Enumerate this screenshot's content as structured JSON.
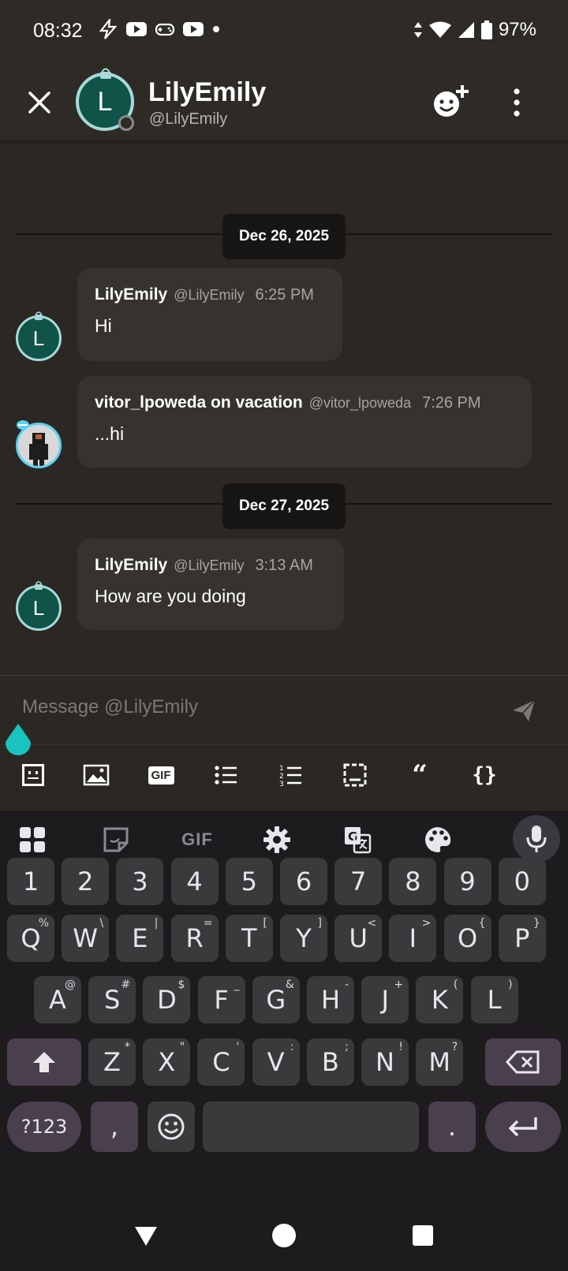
{
  "status_bar": {
    "time": "08:32",
    "battery": "97%"
  },
  "header": {
    "avatar_letter": "L",
    "name": "LilyEmily",
    "handle": "@LilyEmily"
  },
  "chat": {
    "date_separators": [
      "Dec 26, 2025",
      "Dec 27, 2025"
    ],
    "messages": [
      {
        "name": "LilyEmily",
        "handle": "@LilyEmily",
        "time": "6:25 PM",
        "text": "Hi",
        "avatar_letter": "L"
      },
      {
        "name": "vitor_lpoweda on vacation",
        "handle": "@vitor_lpoweda",
        "time": "7:26 PM",
        "text": "...hi"
      },
      {
        "name": "LilyEmily",
        "handle": "@LilyEmily",
        "time": "3:13 AM",
        "text": "How are you doing",
        "avatar_letter": "L"
      }
    ]
  },
  "composer": {
    "placeholder": "Message @LilyEmily"
  },
  "format_toolbar": {
    "gif_label": "GIF",
    "quote_label": "“",
    "code_label": "{}"
  },
  "keyboard": {
    "toolbar_gif": "GIF",
    "number_row": [
      "1",
      "2",
      "3",
      "4",
      "5",
      "6",
      "7",
      "8",
      "9",
      "0"
    ],
    "row1": [
      {
        "k": "Q",
        "h": "%"
      },
      {
        "k": "W",
        "h": "\\"
      },
      {
        "k": "E",
        "h": "|"
      },
      {
        "k": "R",
        "h": "="
      },
      {
        "k": "T",
        "h": "["
      },
      {
        "k": "Y",
        "h": "]"
      },
      {
        "k": "U",
        "h": "<"
      },
      {
        "k": "I",
        "h": ">"
      },
      {
        "k": "O",
        "h": "{"
      },
      {
        "k": "P",
        "h": "}"
      }
    ],
    "row2": [
      {
        "k": "A",
        "h": "@"
      },
      {
        "k": "S",
        "h": "#"
      },
      {
        "k": "D",
        "h": "$"
      },
      {
        "k": "F",
        "h": "_"
      },
      {
        "k": "G",
        "h": "&"
      },
      {
        "k": "H",
        "h": "-"
      },
      {
        "k": "J",
        "h": "+"
      },
      {
        "k": "K",
        "h": "("
      },
      {
        "k": "L",
        "h": ")"
      }
    ],
    "row3": [
      {
        "k": "Z",
        "h": "*"
      },
      {
        "k": "X",
        "h": "\""
      },
      {
        "k": "C",
        "h": "'"
      },
      {
        "k": "V",
        "h": ":"
      },
      {
        "k": "B",
        "h": ";"
      },
      {
        "k": "N",
        "h": "!"
      },
      {
        "k": "M",
        "h": "?"
      }
    ],
    "symbols_key": "?123",
    "comma_key": ",",
    "period_key": "."
  },
  "colors": {
    "background": "#2b2824",
    "bubble": "#36322e",
    "avatar_fill": "#0f5349",
    "avatar_ring": "#a8d9d8",
    "cursor_handle": "#18c4c0",
    "keyboard_bg": "#1d1b1e"
  }
}
